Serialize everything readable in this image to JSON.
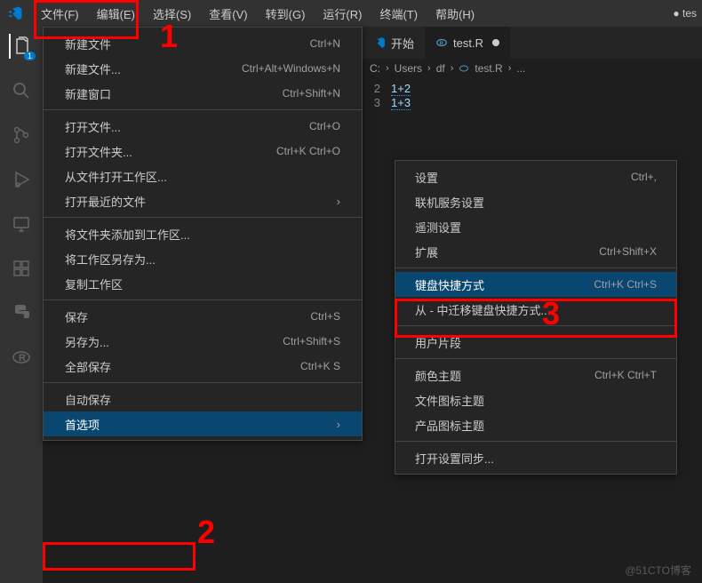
{
  "titlebar": {
    "menus": [
      "文件(F)",
      "编辑(E)",
      "选择(S)",
      "查看(V)",
      "转到(G)",
      "运行(R)",
      "终端(T)",
      "帮助(H)"
    ],
    "right": "● tes"
  },
  "activity": {
    "explorer_badge": "1"
  },
  "tabs": {
    "start": "开始",
    "file": "test.R"
  },
  "crumbs": {
    "c1": "C:",
    "c2": "Users",
    "c3": "df",
    "c4": "test.R",
    "tail": "..."
  },
  "code": {
    "l2": {
      "n": "2",
      "t": "1+2"
    },
    "l3": {
      "n": "3",
      "t": "1+3"
    }
  },
  "file_menu": {
    "g1": [
      {
        "label": "新建文件",
        "sc": "Ctrl+N"
      },
      {
        "label": "新建文件...",
        "sc": "Ctrl+Alt+Windows+N"
      },
      {
        "label": "新建窗口",
        "sc": "Ctrl+Shift+N"
      }
    ],
    "g2": [
      {
        "label": "打开文件...",
        "sc": "Ctrl+O"
      },
      {
        "label": "打开文件夹...",
        "sc": "Ctrl+K Ctrl+O"
      },
      {
        "label": "从文件打开工作区..."
      },
      {
        "label": "打开最近的文件",
        "sub": true
      }
    ],
    "g3": [
      {
        "label": "将文件夹添加到工作区..."
      },
      {
        "label": "将工作区另存为..."
      },
      {
        "label": "复制工作区"
      }
    ],
    "g4": [
      {
        "label": "保存",
        "sc": "Ctrl+S"
      },
      {
        "label": "另存为...",
        "sc": "Ctrl+Shift+S"
      },
      {
        "label": "全部保存",
        "sc": "Ctrl+K S"
      }
    ],
    "g5": [
      {
        "label": "自动保存"
      },
      {
        "label": "首选项",
        "sub": true,
        "hl": true
      }
    ]
  },
  "pref_menu": {
    "g1": [
      {
        "label": "设置",
        "sc": "Ctrl+,"
      },
      {
        "label": "联机服务设置"
      },
      {
        "label": "遥测设置"
      },
      {
        "label": "扩展",
        "sc": "Ctrl+Shift+X"
      }
    ],
    "g2": [
      {
        "label": "键盘快捷方式",
        "sc": "Ctrl+K Ctrl+S",
        "hl": true
      },
      {
        "label": "从 - 中迁移键盘快捷方式..."
      }
    ],
    "g3": [
      {
        "label": "用户片段"
      }
    ],
    "g4": [
      {
        "label": "颜色主题",
        "sc": "Ctrl+K Ctrl+T"
      },
      {
        "label": "文件图标主题"
      },
      {
        "label": "产品图标主题"
      }
    ],
    "g5": [
      {
        "label": "打开设置同步..."
      }
    ]
  },
  "ann": {
    "n1": "1",
    "n2": "2",
    "n3": "3"
  },
  "watermark": "@51CTO博客"
}
